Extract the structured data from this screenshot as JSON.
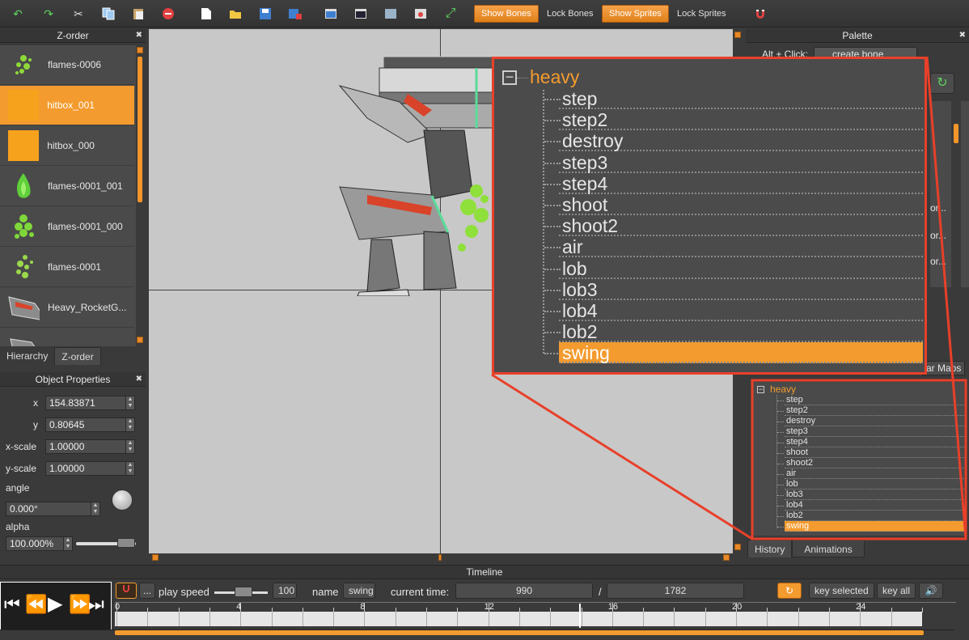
{
  "toolbar": {
    "show_bones": "Show Bones",
    "lock_bones": "Lock Bones",
    "show_sprites": "Show Sprites",
    "lock_sprites": "Lock Sprites"
  },
  "zorder": {
    "title": "Z-order",
    "items": [
      {
        "label": "flames-0006"
      },
      {
        "label": "hitbox_001"
      },
      {
        "label": "hitbox_000"
      },
      {
        "label": "flames-0001_001"
      },
      {
        "label": "flames-0001_000"
      },
      {
        "label": "flames-0001"
      },
      {
        "label": "Heavy_RocketG..."
      }
    ],
    "tabs": [
      "Hierarchy",
      "Z-order"
    ]
  },
  "properties": {
    "title": "Object Properties",
    "x_label": "x",
    "x_value": "154.83871",
    "y_label": "y",
    "y_value": "0.80645",
    "xscale_label": "x-scale",
    "xscale_value": "1.00000",
    "yscale_label": "y-scale",
    "yscale_value": "1.00000",
    "angle_label": "angle",
    "angle_value": "0.000°",
    "alpha_label": "alpha",
    "alpha_value": "100.000%"
  },
  "palette": {
    "title": "Palette",
    "hint_prefix": "Alt + Click:",
    "hint_action": "create bone",
    "tab_fragment": "ar Maps",
    "clipped_rows": [
      "or...",
      "or...",
      "or..."
    ]
  },
  "tree": {
    "root": "heavy",
    "children": [
      "step",
      "step2",
      "destroy",
      "step3",
      "step4",
      "shoot",
      "shoot2",
      "air",
      "lob",
      "lob3",
      "lob4",
      "lob2",
      "swing"
    ],
    "selected": "swing",
    "tabs": [
      "History",
      "Animations"
    ]
  },
  "timeline": {
    "title": "Timeline",
    "play_speed_label": "play speed",
    "play_speed_value": "100",
    "name_label": "name",
    "name_value": "swing",
    "current_time_label": "current time:",
    "current_time": "990",
    "separator": "/",
    "total_time": "1782",
    "key_selected": "key selected",
    "key_all": "key all",
    "more": "...",
    "ruler": [
      "0",
      "4",
      "8",
      "12",
      "16",
      "20",
      "24"
    ]
  },
  "colors": {
    "accent": "#f39b2e",
    "callout": "#e8402a"
  }
}
